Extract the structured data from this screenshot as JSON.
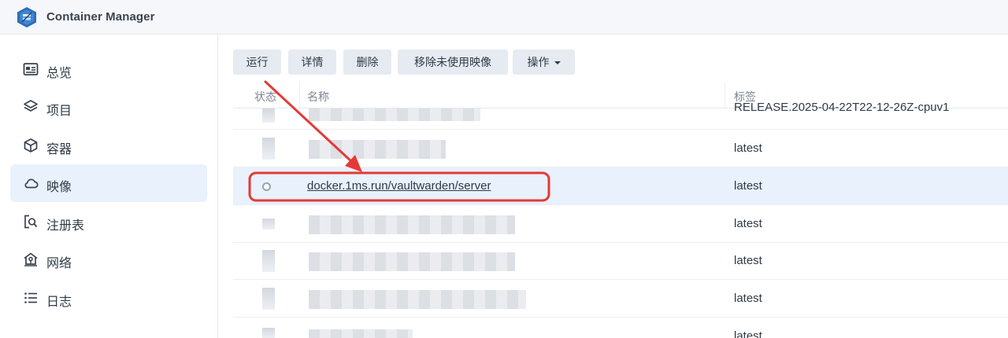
{
  "app": {
    "title": "Container Manager"
  },
  "sidebar": {
    "items": [
      {
        "label": "总览",
        "icon": "overview-card-icon",
        "active": false
      },
      {
        "label": "项目",
        "icon": "layers-icon",
        "active": false
      },
      {
        "label": "容器",
        "icon": "cube-icon",
        "active": false
      },
      {
        "label": "映像",
        "icon": "cloud-icon",
        "active": true
      },
      {
        "label": "注册表",
        "icon": "registry-search-icon",
        "active": false
      },
      {
        "label": "网络",
        "icon": "home-network-icon",
        "active": false
      },
      {
        "label": "日志",
        "icon": "list-icon",
        "active": false
      }
    ]
  },
  "toolbar": {
    "run": "运行",
    "details": "详情",
    "delete": "删除",
    "remove_unused": "移除未使用映像",
    "actions": "操作"
  },
  "table": {
    "headers": {
      "status": "状态",
      "name": "名称",
      "tag": "标签"
    },
    "rows": [
      {
        "name": "",
        "tag": "RELEASE.2025-04-22T22-12-26Z-cpuv1",
        "selected": false
      },
      {
        "name": "",
        "tag": "latest",
        "selected": false
      },
      {
        "name": "docker.1ms.run/vaultwarden/server",
        "tag": "latest",
        "selected": true
      },
      {
        "name": "",
        "tag": "latest",
        "selected": false
      },
      {
        "name": "",
        "tag": "latest",
        "selected": false
      },
      {
        "name": "",
        "tag": "latest",
        "selected": false
      },
      {
        "name": "",
        "tag": "latest",
        "selected": false
      }
    ]
  },
  "colors": {
    "accent": "#e8f1fc",
    "annotation": "#e53935"
  }
}
